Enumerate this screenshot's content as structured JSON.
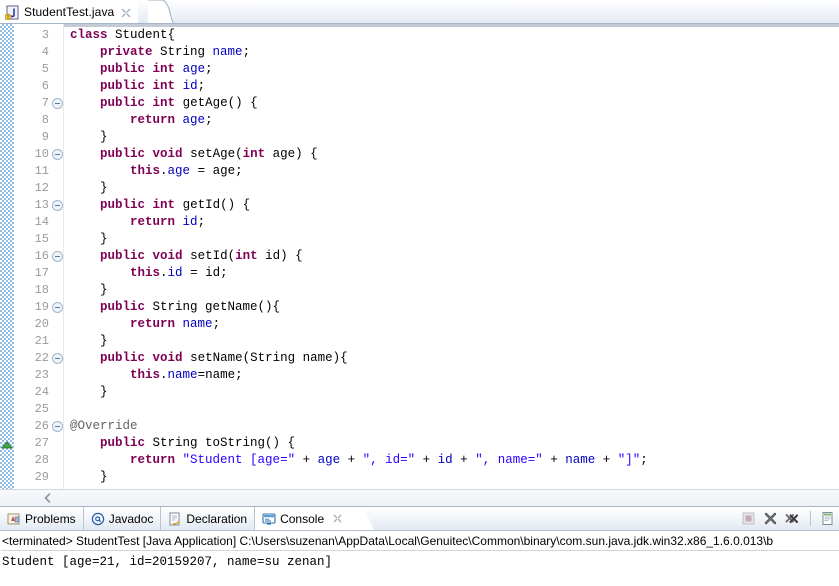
{
  "editor": {
    "tab": {
      "label": "StudentTest.java",
      "icon": "java-file-icon",
      "close_icon": "close-icon"
    },
    "first_line_number": 3,
    "lines": [
      {
        "n": 3,
        "fold": false,
        "marker": null,
        "tokens": [
          {
            "t": "kw",
            "v": "class"
          },
          {
            "t": "pln",
            "v": " Student{"
          }
        ]
      },
      {
        "n": 4,
        "fold": false,
        "marker": null,
        "tokens": [
          {
            "t": "pln",
            "v": "    "
          },
          {
            "t": "kw",
            "v": "private"
          },
          {
            "t": "pln",
            "v": " String "
          },
          {
            "t": "fld",
            "v": "name"
          },
          {
            "t": "pln",
            "v": ";"
          }
        ]
      },
      {
        "n": 5,
        "fold": false,
        "marker": null,
        "tokens": [
          {
            "t": "pln",
            "v": "    "
          },
          {
            "t": "kw",
            "v": "public"
          },
          {
            "t": "pln",
            "v": " "
          },
          {
            "t": "kw",
            "v": "int"
          },
          {
            "t": "pln",
            "v": " "
          },
          {
            "t": "fld",
            "v": "age"
          },
          {
            "t": "pln",
            "v": ";"
          }
        ]
      },
      {
        "n": 6,
        "fold": false,
        "marker": null,
        "tokens": [
          {
            "t": "pln",
            "v": "    "
          },
          {
            "t": "kw",
            "v": "public"
          },
          {
            "t": "pln",
            "v": " "
          },
          {
            "t": "kw",
            "v": "int"
          },
          {
            "t": "pln",
            "v": " "
          },
          {
            "t": "fld",
            "v": "id"
          },
          {
            "t": "pln",
            "v": ";"
          }
        ]
      },
      {
        "n": 7,
        "fold": true,
        "marker": null,
        "tokens": [
          {
            "t": "pln",
            "v": "    "
          },
          {
            "t": "kw",
            "v": "public"
          },
          {
            "t": "pln",
            "v": " "
          },
          {
            "t": "kw",
            "v": "int"
          },
          {
            "t": "pln",
            "v": " getAge() {"
          }
        ]
      },
      {
        "n": 8,
        "fold": false,
        "marker": null,
        "tokens": [
          {
            "t": "pln",
            "v": "        "
          },
          {
            "t": "kw",
            "v": "return"
          },
          {
            "t": "pln",
            "v": " "
          },
          {
            "t": "fld",
            "v": "age"
          },
          {
            "t": "pln",
            "v": ";"
          }
        ]
      },
      {
        "n": 9,
        "fold": false,
        "marker": null,
        "tokens": [
          {
            "t": "pln",
            "v": "    }"
          }
        ]
      },
      {
        "n": 10,
        "fold": true,
        "marker": null,
        "tokens": [
          {
            "t": "pln",
            "v": "    "
          },
          {
            "t": "kw",
            "v": "public"
          },
          {
            "t": "pln",
            "v": " "
          },
          {
            "t": "kw",
            "v": "void"
          },
          {
            "t": "pln",
            "v": " setAge("
          },
          {
            "t": "kw",
            "v": "int"
          },
          {
            "t": "pln",
            "v": " age) {"
          }
        ]
      },
      {
        "n": 11,
        "fold": false,
        "marker": null,
        "tokens": [
          {
            "t": "pln",
            "v": "        "
          },
          {
            "t": "kw",
            "v": "this"
          },
          {
            "t": "pln",
            "v": "."
          },
          {
            "t": "fld",
            "v": "age"
          },
          {
            "t": "pln",
            "v": " = age;"
          }
        ]
      },
      {
        "n": 12,
        "fold": false,
        "marker": null,
        "tokens": [
          {
            "t": "pln",
            "v": "    }"
          }
        ]
      },
      {
        "n": 13,
        "fold": true,
        "marker": null,
        "tokens": [
          {
            "t": "pln",
            "v": "    "
          },
          {
            "t": "kw",
            "v": "public"
          },
          {
            "t": "pln",
            "v": " "
          },
          {
            "t": "kw",
            "v": "int"
          },
          {
            "t": "pln",
            "v": " getId() {"
          }
        ]
      },
      {
        "n": 14,
        "fold": false,
        "marker": null,
        "tokens": [
          {
            "t": "pln",
            "v": "        "
          },
          {
            "t": "kw",
            "v": "return"
          },
          {
            "t": "pln",
            "v": " "
          },
          {
            "t": "fld",
            "v": "id"
          },
          {
            "t": "pln",
            "v": ";"
          }
        ]
      },
      {
        "n": 15,
        "fold": false,
        "marker": null,
        "tokens": [
          {
            "t": "pln",
            "v": "    }"
          }
        ]
      },
      {
        "n": 16,
        "fold": true,
        "marker": null,
        "tokens": [
          {
            "t": "pln",
            "v": "    "
          },
          {
            "t": "kw",
            "v": "public"
          },
          {
            "t": "pln",
            "v": " "
          },
          {
            "t": "kw",
            "v": "void"
          },
          {
            "t": "pln",
            "v": " setId("
          },
          {
            "t": "kw",
            "v": "int"
          },
          {
            "t": "pln",
            "v": " id) {"
          }
        ]
      },
      {
        "n": 17,
        "fold": false,
        "marker": null,
        "tokens": [
          {
            "t": "pln",
            "v": "        "
          },
          {
            "t": "kw",
            "v": "this"
          },
          {
            "t": "pln",
            "v": "."
          },
          {
            "t": "fld",
            "v": "id"
          },
          {
            "t": "pln",
            "v": " = id;"
          }
        ]
      },
      {
        "n": 18,
        "fold": false,
        "marker": null,
        "tokens": [
          {
            "t": "pln",
            "v": "    }"
          }
        ]
      },
      {
        "n": 19,
        "fold": true,
        "marker": null,
        "tokens": [
          {
            "t": "pln",
            "v": "    "
          },
          {
            "t": "kw",
            "v": "public"
          },
          {
            "t": "pln",
            "v": " String getName(){"
          }
        ]
      },
      {
        "n": 20,
        "fold": false,
        "marker": null,
        "tokens": [
          {
            "t": "pln",
            "v": "        "
          },
          {
            "t": "kw",
            "v": "return"
          },
          {
            "t": "pln",
            "v": " "
          },
          {
            "t": "fld",
            "v": "name"
          },
          {
            "t": "pln",
            "v": ";"
          }
        ]
      },
      {
        "n": 21,
        "fold": false,
        "marker": null,
        "tokens": [
          {
            "t": "pln",
            "v": "    }"
          }
        ]
      },
      {
        "n": 22,
        "fold": true,
        "marker": null,
        "tokens": [
          {
            "t": "pln",
            "v": "    "
          },
          {
            "t": "kw",
            "v": "public"
          },
          {
            "t": "pln",
            "v": " "
          },
          {
            "t": "kw",
            "v": "void"
          },
          {
            "t": "pln",
            "v": " setName(String name){"
          }
        ]
      },
      {
        "n": 23,
        "fold": false,
        "marker": null,
        "tokens": [
          {
            "t": "pln",
            "v": "        "
          },
          {
            "t": "kw",
            "v": "this"
          },
          {
            "t": "pln",
            "v": "."
          },
          {
            "t": "fld",
            "v": "name"
          },
          {
            "t": "pln",
            "v": "=name;"
          }
        ]
      },
      {
        "n": 24,
        "fold": false,
        "marker": null,
        "tokens": [
          {
            "t": "pln",
            "v": "    }"
          }
        ]
      },
      {
        "n": 25,
        "fold": false,
        "marker": null,
        "tokens": [
          {
            "t": "pln",
            "v": ""
          }
        ]
      },
      {
        "n": 26,
        "fold": true,
        "marker": null,
        "tokens": [
          {
            "t": "ann",
            "v": "@Override"
          }
        ]
      },
      {
        "n": 27,
        "fold": false,
        "marker": "override-marker",
        "tokens": [
          {
            "t": "pln",
            "v": "    "
          },
          {
            "t": "kw",
            "v": "public"
          },
          {
            "t": "pln",
            "v": " String toString() {"
          }
        ]
      },
      {
        "n": 28,
        "fold": false,
        "marker": null,
        "tokens": [
          {
            "t": "pln",
            "v": "        "
          },
          {
            "t": "kw",
            "v": "return"
          },
          {
            "t": "pln",
            "v": " "
          },
          {
            "t": "str",
            "v": "\"Student [age=\""
          },
          {
            "t": "pln",
            "v": " + "
          },
          {
            "t": "fld",
            "v": "age"
          },
          {
            "t": "pln",
            "v": " + "
          },
          {
            "t": "str",
            "v": "\", id=\""
          },
          {
            "t": "pln",
            "v": " + "
          },
          {
            "t": "fld",
            "v": "id"
          },
          {
            "t": "pln",
            "v": " + "
          },
          {
            "t": "str",
            "v": "\", name=\""
          },
          {
            "t": "pln",
            "v": " + "
          },
          {
            "t": "fld",
            "v": "name"
          },
          {
            "t": "pln",
            "v": " + "
          },
          {
            "t": "str",
            "v": "\"]\""
          },
          {
            "t": "pln",
            "v": ";"
          }
        ]
      },
      {
        "n": 29,
        "fold": false,
        "marker": null,
        "tokens": [
          {
            "t": "pln",
            "v": "    }"
          }
        ]
      }
    ],
    "hscroll_left_icon": "scroll-left-icon"
  },
  "console_panel": {
    "tabs": [
      {
        "label": "Problems",
        "icon": "problems-icon",
        "active": false,
        "closeable": false
      },
      {
        "label": "Javadoc",
        "icon": "javadoc-icon",
        "active": false,
        "closeable": false
      },
      {
        "label": "Declaration",
        "icon": "declaration-icon",
        "active": false,
        "closeable": false
      },
      {
        "label": "Console",
        "icon": "console-icon",
        "active": true,
        "closeable": true
      }
    ],
    "tools": [
      {
        "name": "terminate-icon",
        "title": "Terminate"
      },
      {
        "name": "remove-launch-icon",
        "title": "Remove Launch"
      },
      {
        "name": "remove-all-terminated-icon",
        "title": "Remove All Terminated Launches"
      },
      {
        "name": "clear-console-icon",
        "title": "Clear Console"
      }
    ],
    "output": {
      "header": "<terminated> StudentTest [Java Application] C:\\Users\\suzenan\\AppData\\Local\\Genuitec\\Common\\binary\\com.sun.java.jdk.win32.x86_1.6.0.013\\b",
      "lines": [
        "Student [age=21, id=20159207, name=su zenan]"
      ]
    }
  },
  "colors": {
    "keyword": "#7f0055",
    "field": "#0000c0",
    "string": "#2a00ff",
    "annotation": "#646464",
    "line_number": "#9b9b9b",
    "ruler_blue": "#8fbde0",
    "marker_green": "#3faa3f"
  }
}
